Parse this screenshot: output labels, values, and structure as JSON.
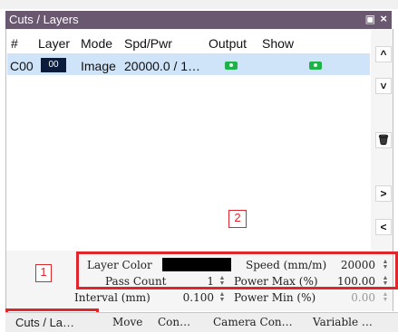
{
  "window": {
    "title": "Cuts / Layers"
  },
  "table": {
    "headers": [
      "#",
      "Layer",
      "Mode",
      "Spd/Pwr",
      "Output",
      "Show"
    ],
    "rows": [
      {
        "id": "C00",
        "layer": "00",
        "mode": "Image",
        "spd_pwr": "20000.0 / 1…"
      }
    ]
  },
  "side_buttons": [
    {
      "icon": "chevron-up-icon",
      "glyph": "^"
    },
    {
      "icon": "chevron-down-icon",
      "glyph": "˅"
    },
    {
      "icon": "trash-icon",
      "glyph": "🗑"
    },
    {
      "icon": "chevron-right-icon",
      "glyph": ">"
    },
    {
      "icon": "chevron-left-icon",
      "glyph": "<"
    }
  ],
  "settings": {
    "layer_color_label": "Layer Color",
    "speed_label": "Speed (mm/m)",
    "speed_value": "20000",
    "pass_count_label": "Pass Count",
    "pass_count_value": "1",
    "power_max_label": "Power Max (%)",
    "power_max_value": "100.00",
    "interval_label": "Interval (mm)",
    "interval_value": "0.100",
    "power_min_label": "Power Min (%)",
    "power_min_value": "0.00"
  },
  "annotations": {
    "one": "1",
    "two": "2"
  },
  "tabs": [
    "Cuts / La…",
    "Move",
    "Con…",
    "Camera Con…",
    "Variable …"
  ],
  "colors": {
    "title_bar": "#6a5870",
    "selected_row": "#cfe4f8",
    "highlight": "#e0262d",
    "output_on": "#1fb24a"
  }
}
